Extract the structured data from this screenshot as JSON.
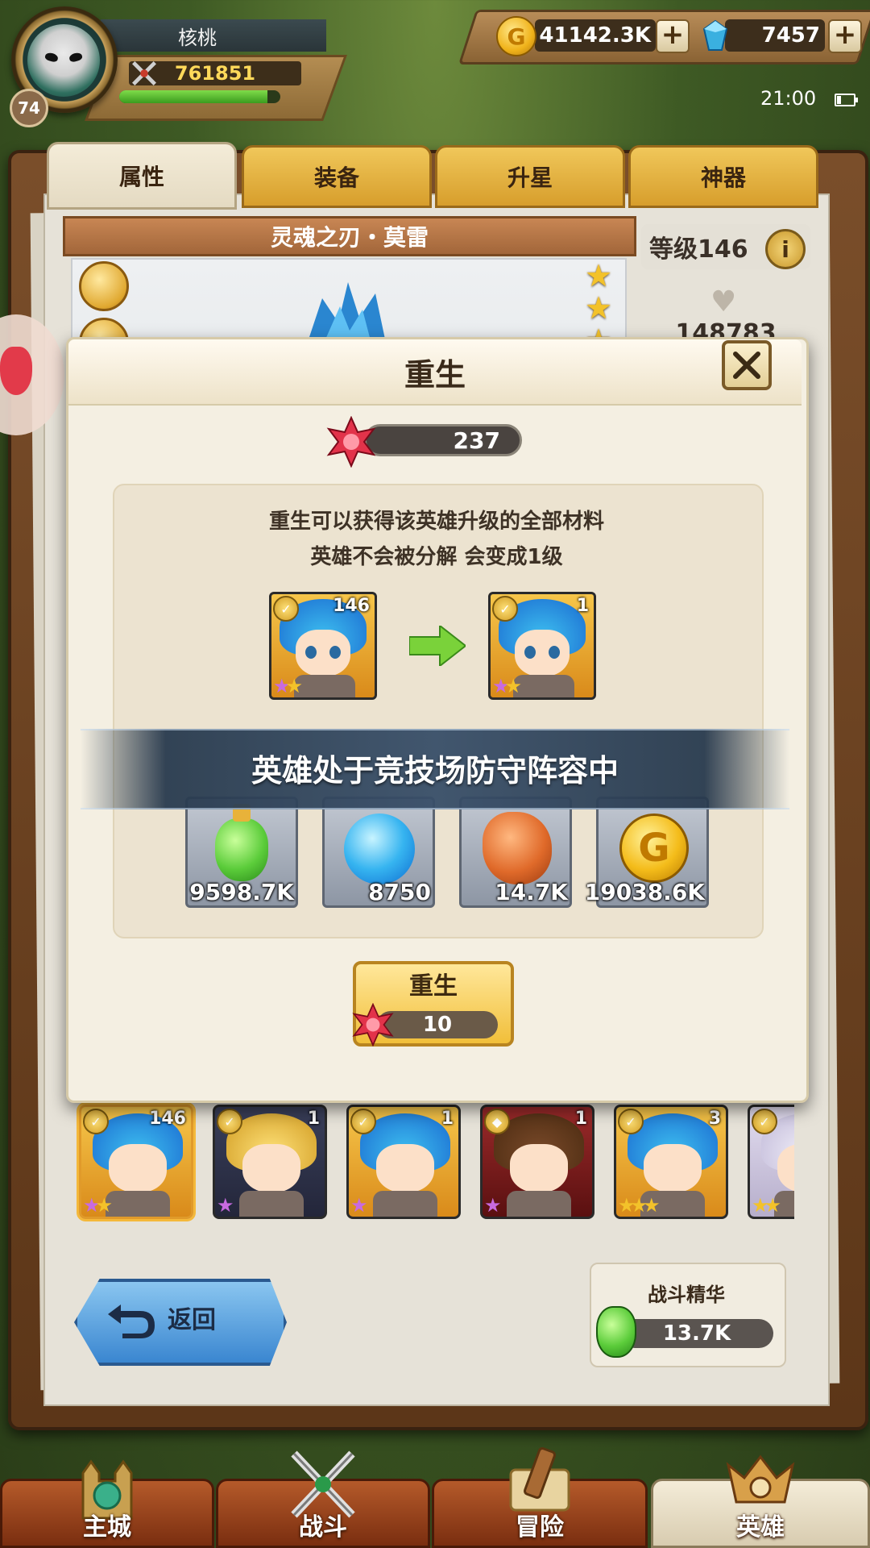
{
  "player": {
    "name": "核桃",
    "level": "74",
    "power": "761851",
    "exp_fraction": 0.92
  },
  "resources": {
    "gold": "41142.3K",
    "gems": "7457"
  },
  "status": {
    "time": "21:00",
    "battery_fraction": 0.25
  },
  "tabs": [
    {
      "label": "属性",
      "active": true
    },
    {
      "label": "装备",
      "active": false
    },
    {
      "label": "升星",
      "active": false
    },
    {
      "label": "神器",
      "active": false
    }
  ],
  "hero": {
    "title": "灵魂之刃・莫雷",
    "level_text": "等级146",
    "hp": "148783"
  },
  "modal": {
    "title": "重生",
    "essence_count": "237",
    "desc_line1": "重生可以获得该英雄升级的全部材料",
    "desc_line2": "英雄不会被分解 会变成1级",
    "from_level": "146",
    "to_level": "1",
    "banner": "英雄处于竞技场防守阵容中",
    "materials": [
      {
        "icon": "potion-icon",
        "value": "9598.7K"
      },
      {
        "icon": "orb-icon",
        "value": "8750"
      },
      {
        "icon": "ore-icon",
        "value": "14.7K"
      },
      {
        "icon": "gold-coin-icon",
        "value": "19038.6K"
      }
    ],
    "button_label": "重生",
    "button_cost": "10"
  },
  "roster": [
    {
      "level": "146",
      "selected": true
    },
    {
      "level": "1",
      "selected": false
    },
    {
      "level": "1",
      "selected": false
    },
    {
      "level": "1",
      "selected": false
    },
    {
      "level": "3",
      "selected": false
    },
    {
      "level": "",
      "selected": false
    }
  ],
  "bottom": {
    "back_label": "返回",
    "essence_label": "战斗精华",
    "essence_value": "13.7K"
  },
  "nav": [
    {
      "label": "主城",
      "icon": "castle-icon",
      "active": false
    },
    {
      "label": "战斗",
      "icon": "crossed-swords-icon",
      "active": false
    },
    {
      "label": "冒险",
      "icon": "scroll-map-icon",
      "active": false
    },
    {
      "label": "英雄",
      "icon": "hero-helmet-icon",
      "active": true
    }
  ]
}
